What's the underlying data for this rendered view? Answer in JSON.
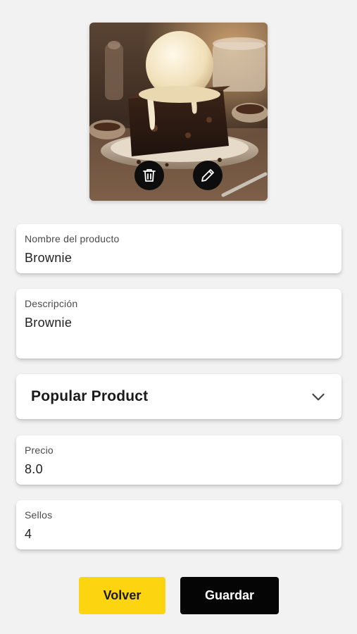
{
  "product_image": {
    "icon": "brownie-with-ice-cream-photo",
    "delete_icon": "trash-icon",
    "edit_icon": "pencil-icon"
  },
  "form": {
    "name": {
      "label": "Nombre del producto",
      "value": "Brownie"
    },
    "description": {
      "label": "Descripción",
      "value": "Brownie"
    },
    "category": {
      "selected": "Popular Product",
      "icon": "chevron-down-icon"
    },
    "price": {
      "label": "Precio",
      "value": "8.0"
    },
    "seals": {
      "label": "Sellos",
      "value": "4"
    }
  },
  "actions": {
    "back_label": "Volver",
    "save_label": "Guardar"
  },
  "colors": {
    "background": "#f2f2f2",
    "back_button": "#fcd40f",
    "save_button": "#050505"
  }
}
